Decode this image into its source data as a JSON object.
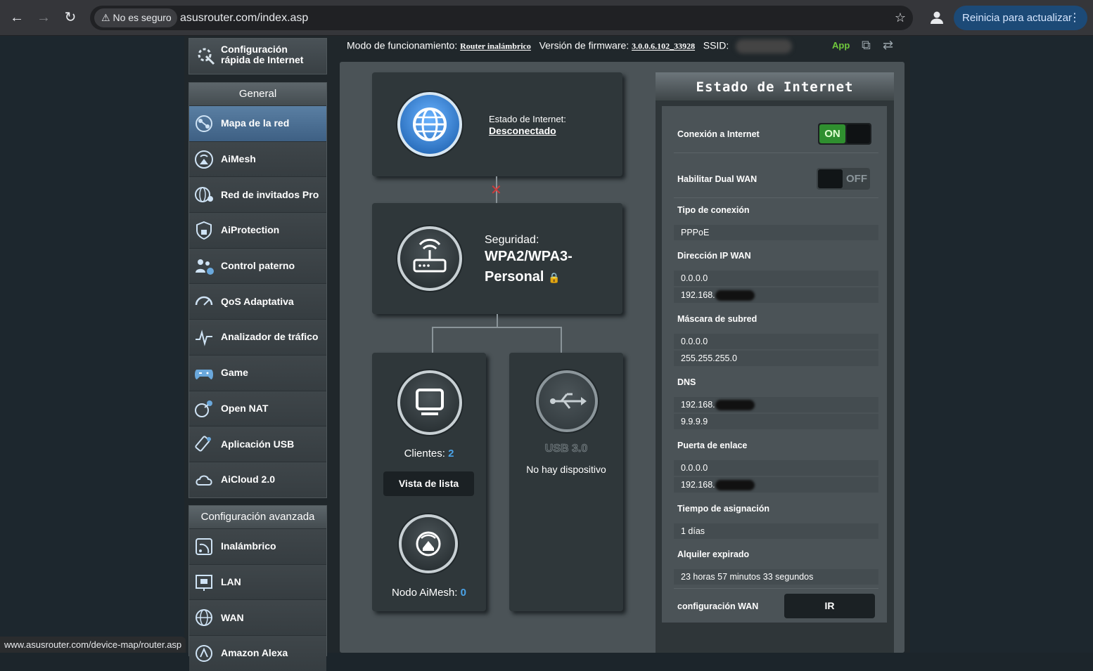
{
  "browser": {
    "security_label": "No es seguro",
    "url": "asusrouter.com/index.asp",
    "update_label": "Reinicia para actualizar",
    "status_url": "www.asusrouter.com/device-map/router.asp"
  },
  "topbar": {
    "mode_label": "Modo de funcionamiento:",
    "mode_value": "Router inalámbrico",
    "fw_label": "Versión de firmware:",
    "fw_value": "3.0.0.6.102_33928",
    "ssid_label": "SSID:",
    "app_label": "App"
  },
  "sidebar": {
    "quick_setup": "Configuración rápida de Internet",
    "general_header": "General",
    "general_items": [
      {
        "label": "Mapa de la red",
        "icon": "network-map-icon"
      },
      {
        "label": "AiMesh",
        "icon": "aimesh-icon"
      },
      {
        "label": "Red de invitados Pro",
        "icon": "guest-network-icon"
      },
      {
        "label": "AiProtection",
        "icon": "shield-icon"
      },
      {
        "label": "Control paterno",
        "icon": "parental-control-icon"
      },
      {
        "label": "QoS Adaptativa",
        "icon": "qos-icon"
      },
      {
        "label": "Analizador de tráfico",
        "icon": "traffic-analyzer-icon"
      },
      {
        "label": "Game",
        "icon": "gamepad-icon"
      },
      {
        "label": "Open NAT",
        "icon": "open-nat-icon"
      },
      {
        "label": "Aplicación USB",
        "icon": "usb-app-icon"
      },
      {
        "label": "AiCloud 2.0",
        "icon": "cloud-icon"
      }
    ],
    "advanced_header": "Configuración avanzada",
    "advanced_items": [
      {
        "label": "Inalámbrico",
        "icon": "wireless-icon"
      },
      {
        "label": "LAN",
        "icon": "lan-icon"
      },
      {
        "label": "WAN",
        "icon": "wan-globe-icon"
      },
      {
        "label": "Amazon Alexa",
        "icon": "alexa-icon"
      }
    ]
  },
  "map": {
    "internet_status_label": "Estado de Internet:",
    "internet_status_value": "Desconectado",
    "security_label": "Seguridad:",
    "security_value": "WPA2/WPA3-Personal",
    "clients_label": "Clientes:",
    "clients_count": "2",
    "list_view_button": "Vista de lista",
    "usb_title": "USB 3.0",
    "usb_status": "No hay dispositivo",
    "aimesh_label": "Nodo AiMesh:",
    "aimesh_count": "0"
  },
  "status": {
    "title": "Estado de Internet",
    "internet_conn_label": "Conexión a Internet",
    "internet_conn_state": "ON",
    "dual_wan_label": "Habilitar Dual WAN",
    "dual_wan_state": "OFF",
    "conn_type_label": "Tipo de conexión",
    "conn_type_value": "PPPoE",
    "wan_ip_label": "Dirección IP WAN",
    "wan_ip_1": "0.0.0.0",
    "wan_ip_2": "192.168.",
    "subnet_label": "Máscara de subred",
    "subnet_1": "0.0.0.0",
    "subnet_2": "255.255.255.0",
    "dns_label": "DNS",
    "dns_1": "192.168.",
    "dns_2": "9.9.9.9",
    "gateway_label": "Puerta de enlace",
    "gateway_1": "0.0.0.0",
    "gateway_2": "192.168.",
    "lease_label": "Tiempo de asignación",
    "lease_value": "1 días",
    "lease_expire_label": "Alquiler expirado",
    "lease_expire_value": "23 horas 57 minutos 33 segundos",
    "wan_config_label": "configuración WAN",
    "go_button": "IR"
  },
  "colors": {
    "on_green": "#2f8f2f",
    "accent_link": "#70c83c",
    "count_blue": "#4aa3e8",
    "active_menu": "#4b6f93",
    "update_btn": "#1c4a77"
  }
}
